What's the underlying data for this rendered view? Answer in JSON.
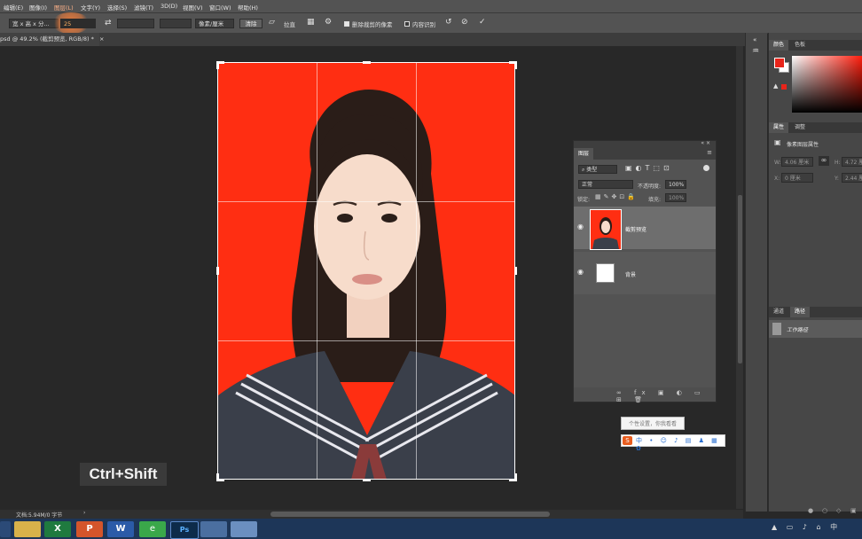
{
  "menu": [
    "编辑(E)",
    "图像(I)",
    "图层(L)",
    "文字(Y)",
    "选择(S)",
    "滤镜(T)",
    "3D(D)",
    "视图(V)",
    "窗口(W)",
    "帮助(H)"
  ],
  "options": {
    "ratio_select": "宽 x 高 x 分...",
    "width_value": "25",
    "unit_select": "像素/厘米",
    "clear_label": "清除",
    "straighten_label": "拉直",
    "delete_cropped_label": "删除裁剪的像素",
    "content_aware_label": "内容识别"
  },
  "document": {
    "tab_title": "psd @ 49.2% (截剪预览, RGB/8) *",
    "status": "文档:5.94M/0 字节"
  },
  "key_hint": "Ctrl+Shift",
  "panels": {
    "color_tabs": [
      "颜色",
      "色板"
    ],
    "properties_tabs": [
      "属性",
      "调整"
    ],
    "properties_title": "像素图层属性",
    "w_label": "W:",
    "w_value": "4.06 厘米",
    "h_label": "H:",
    "h_value": "4.72 厘",
    "x_label": "X:",
    "x_value": "0 厘米",
    "y_label": "Y:",
    "y_value": "2.44 厘",
    "paths_tabs": [
      "通道",
      "路径"
    ],
    "path_item": "工作路径"
  },
  "layers": {
    "title": "图层",
    "kind_filter": "类型",
    "blend_mode": "正常",
    "opacity_label": "不透明度:",
    "opacity_value": "100%",
    "lock_label": "锁定:",
    "fill_label": "填充:",
    "fill_value": "100%",
    "items": [
      {
        "name": "截剪预览"
      },
      {
        "name": "背景"
      }
    ]
  },
  "ime": {
    "tip": "个性设置，你我看看"
  },
  "colors": {
    "foreground": "#e8241a",
    "background": "#ffffff",
    "photo_bg": "#ff2e12"
  }
}
